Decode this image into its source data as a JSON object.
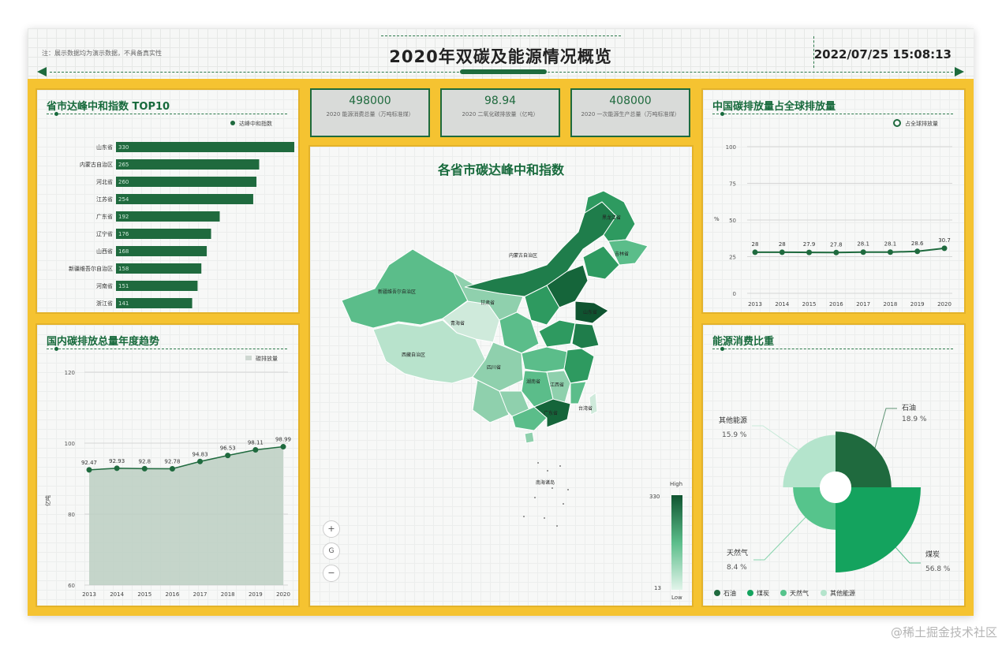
{
  "header": {
    "note": "注：展示数据均为演示数据，不具备真实性",
    "title": "2020年双碳及能源情况概览",
    "datetime": "2022/07/25 15:08:13"
  },
  "kpis": [
    {
      "value": "498000",
      "label": "2020 能源消费总量（万吨标准煤）"
    },
    {
      "value": "98.94",
      "label": "2020 二氧化碳排放量（亿吨）"
    },
    {
      "value": "408000",
      "label": "2020 一次能源生产总量（万吨标准煤）"
    }
  ],
  "top10": {
    "title": "省市达峰中和指数 TOP10",
    "legend": "达峰中和指数",
    "bar_color": "#1f6a3e",
    "items": [
      {
        "name": "山东省",
        "value": 330
      },
      {
        "name": "内蒙古自治区",
        "value": 265
      },
      {
        "name": "河北省",
        "value": 260
      },
      {
        "name": "江苏省",
        "value": 254
      },
      {
        "name": "广东省",
        "value": 192
      },
      {
        "name": "辽宁省",
        "value": 176
      },
      {
        "name": "山西省",
        "value": 168
      },
      {
        "name": "新疆维吾尔自治区",
        "value": 158
      },
      {
        "name": "河南省",
        "value": 151
      },
      {
        "name": "浙江省",
        "value": 141
      }
    ]
  },
  "trend": {
    "title": "国内碳排放总量年度趋势",
    "legend": "碳排放量",
    "ylabel": "亿吨",
    "chart_data": {
      "type": "area",
      "x": [
        "2013",
        "2014",
        "2015",
        "2016",
        "2017",
        "2018",
        "2019",
        "2020"
      ],
      "values": [
        92.47,
        92.93,
        92.8,
        92.78,
        94.83,
        96.53,
        98.11,
        98.99
      ],
      "ylim": [
        60,
        120
      ],
      "yticks": [
        60,
        80,
        100,
        120
      ]
    }
  },
  "map": {
    "title": "各省市碳达峰中和指数",
    "legend_high": "High",
    "legend_low": "Low",
    "legend_max": "330",
    "legend_min": "13",
    "zoom_in": "+",
    "reset": "G",
    "zoom_out": "−",
    "labels": [
      "内蒙古自治区",
      "新疆维吾尔自治区",
      "西藏自治区",
      "青海省",
      "甘肃省",
      "黑龙江省",
      "吉林省",
      "山东省",
      "四川省",
      "广东省",
      "湖南省",
      "江西省",
      "台湾省",
      "南海诸岛"
    ]
  },
  "share": {
    "title": "中国碳排放量占全球排放量",
    "legend": "占全球排放量",
    "ylabel": "%",
    "chart_data": {
      "type": "line",
      "x": [
        "2013",
        "2014",
        "2015",
        "2016",
        "2017",
        "2018",
        "2019",
        "2020"
      ],
      "values": [
        28,
        28,
        27.9,
        27.8,
        28.1,
        28.1,
        28.6,
        30.7
      ],
      "ylim": [
        0,
        100
      ],
      "yticks": [
        0,
        25,
        50,
        75,
        100
      ]
    }
  },
  "energy": {
    "title": "能源消费比重",
    "chart_data": {
      "type": "pie",
      "slices": [
        {
          "name": "石油",
          "value": 18.9,
          "label": "18.9 %",
          "color": "#1f6a3e"
        },
        {
          "name": "煤炭",
          "value": 56.8,
          "label": "56.8 %",
          "color": "#14a35e"
        },
        {
          "name": "天然气",
          "value": 8.4,
          "label": "8.4 %",
          "color": "#56c48c"
        },
        {
          "name": "其他能源",
          "value": 15.9,
          "label": "15.9 %",
          "color": "#b4e4cc"
        }
      ]
    }
  },
  "watermark": "@稀土掘金技术社区"
}
